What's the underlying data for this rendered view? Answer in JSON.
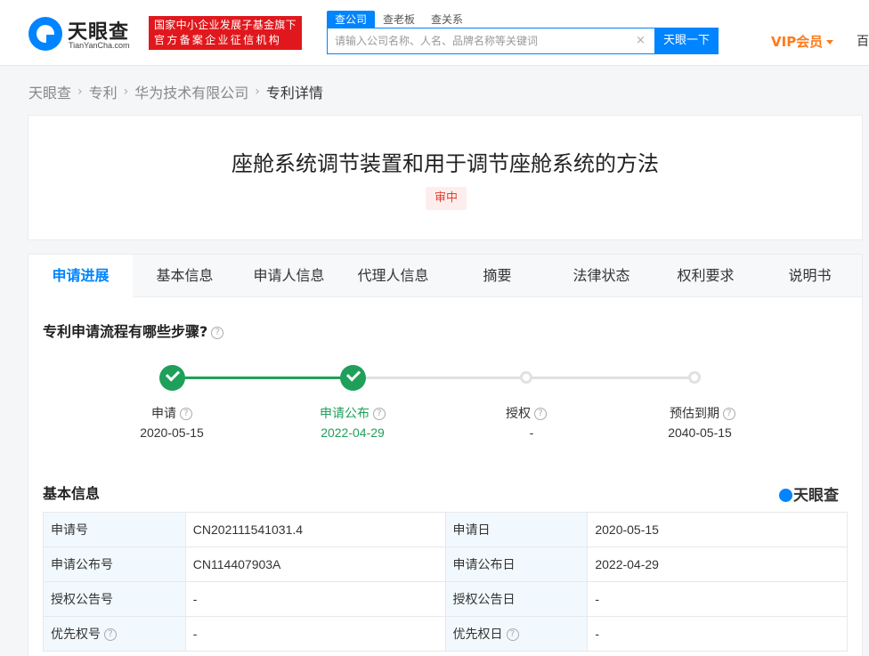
{
  "header": {
    "logo_text": "天眼查",
    "logo_sub": "TianYanCha.com",
    "promo_line1": "国家中小企业发展子基金旗下",
    "promo_line2": "官方备案企业征信机构",
    "search_tabs": [
      "查公司",
      "查老板",
      "查关系"
    ],
    "search_placeholder": "请输入公司名称、人名、品牌名称等关键词",
    "clear_glyph": "×",
    "search_button": "天眼一下",
    "vip_label": "VIP会员",
    "cut_text": "百"
  },
  "breadcrumb": {
    "items": [
      "天眼查",
      "专利",
      "华为技术有限公司",
      "专利详情"
    ],
    "separator": "›"
  },
  "patent": {
    "title": "座舱系统调节装置和用于调节座舱系统的方法",
    "status": "审中"
  },
  "tabs": [
    "申请进展",
    "基本信息",
    "申请人信息",
    "代理人信息",
    "摘要",
    "法律状态",
    "权利要求",
    "说明书"
  ],
  "progress": {
    "title": "专利申请流程有哪些步骤?",
    "help_glyph": "?",
    "steps": [
      {
        "label": "申请",
        "date": "2020-05-15",
        "done": true
      },
      {
        "label": "申请公布",
        "date": "2022-04-29",
        "done": true
      },
      {
        "label": "授权",
        "date": "-",
        "done": false
      },
      {
        "label": "预估到期",
        "date": "2040-05-15",
        "done": false
      }
    ]
  },
  "basic_info": {
    "title": "基本信息",
    "brand": "天眼查",
    "rows": [
      {
        "k1": "申请号",
        "v1": "CN202111541031.4",
        "k2": "申请日",
        "v2": "2020-05-15"
      },
      {
        "k1": "申请公布号",
        "v1": "CN114407903A",
        "k2": "申请公布日",
        "v2": "2022-04-29"
      },
      {
        "k1": "授权公告号",
        "v1": "-",
        "k2": "授权公告日",
        "v2": "-"
      },
      {
        "k1": "优先权号",
        "v1": "-",
        "k2": "优先权日",
        "v2": "-"
      }
    ]
  },
  "colors": {
    "brand_blue": "#0084ff",
    "progress_green": "#1fa05a",
    "promo_red": "#e0181d",
    "vip_orange": "#ff7a1a"
  }
}
